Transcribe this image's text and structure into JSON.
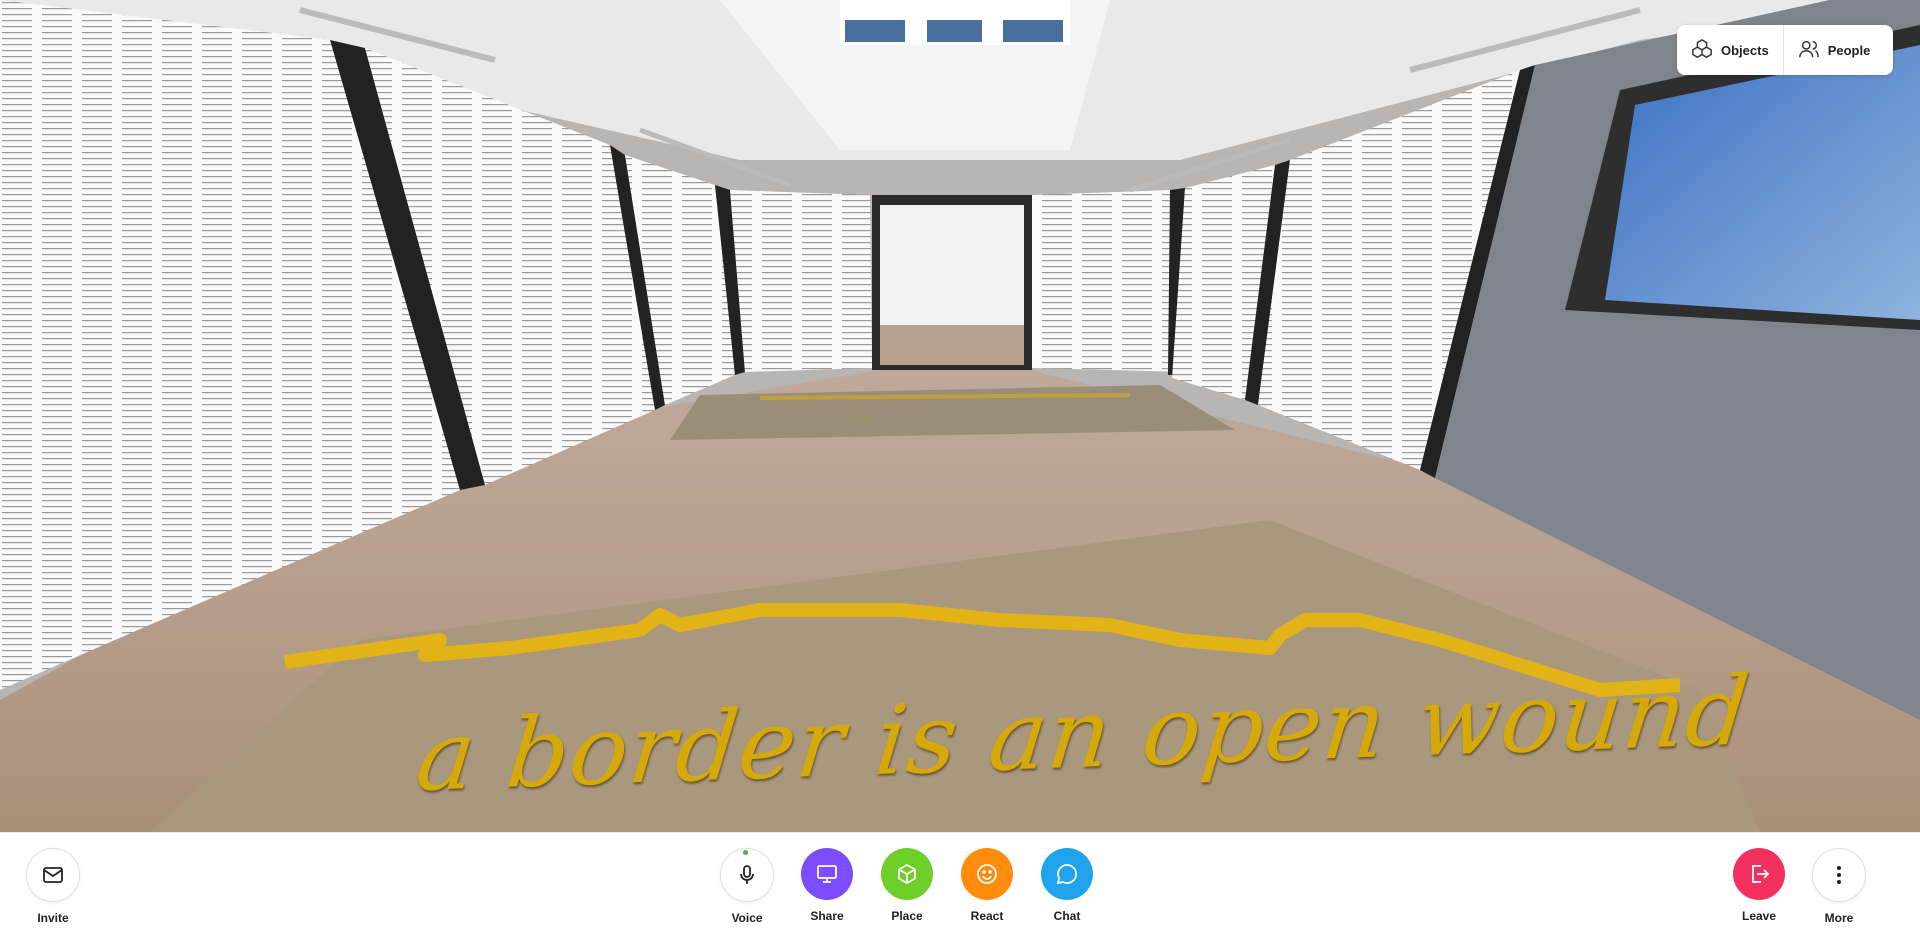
{
  "scene": {
    "floor_text": "a border is an open wound",
    "far_floor_text": "…"
  },
  "topbar": {
    "objects_label": "Objects",
    "people_label": "People"
  },
  "toolbar": {
    "invite_label": "Invite",
    "voice_label": "Voice",
    "share_label": "Share",
    "place_label": "Place",
    "react_label": "React",
    "chat_label": "Chat",
    "leave_label": "Leave",
    "more_label": "More"
  },
  "colors": {
    "share": "#7b4dff",
    "place": "#6fcf2a",
    "react": "#ff8c0a",
    "chat": "#1fa3ec",
    "leave": "#f3315e",
    "floor_text": "#d6a90a"
  },
  "icons": [
    "mail-icon",
    "mic-icon",
    "monitor-icon",
    "cube-icon",
    "smile-icon",
    "chat-bubble-icon",
    "exit-icon",
    "more-vertical-icon",
    "objects-icon",
    "people-icon"
  ]
}
